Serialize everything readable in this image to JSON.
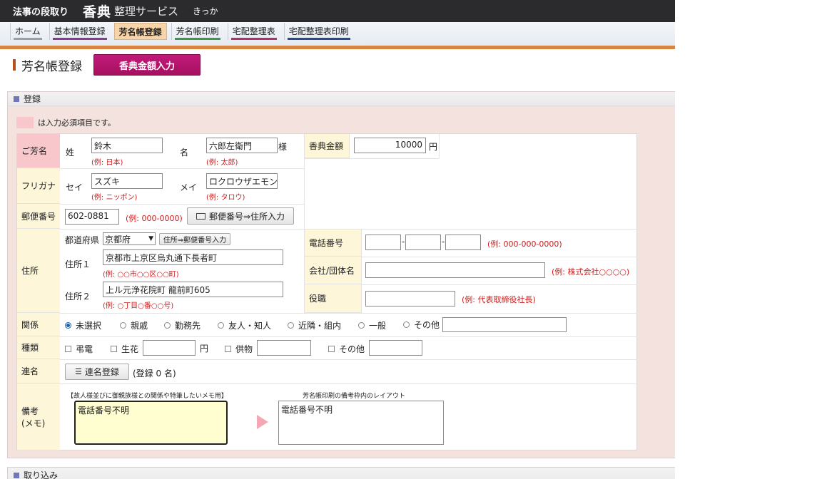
{
  "header": {
    "t1": "法事の段取り",
    "t2": "香典",
    "t3": "整理サービス",
    "t4": "きっか"
  },
  "nav": [
    {
      "label": "ホーム",
      "color": "#9aa0a6"
    },
    {
      "label": "基本情報登録",
      "color": "#8b3a8f"
    },
    {
      "label": "芳名帳登録",
      "color": "#d78541",
      "active": true
    },
    {
      "label": "芳名帳印刷",
      "color": "#3a9a4a"
    },
    {
      "label": "宅配整理表",
      "color": "#b0306a"
    },
    {
      "label": "宅配整理表印刷",
      "color": "#2a4a8f"
    }
  ],
  "page": {
    "title": "芳名帳登録",
    "koden_button": "香典金額入力"
  },
  "panel": {
    "title": "登録",
    "legend": "は入力必須項目です。",
    "panel2_title": "取り込み"
  },
  "form": {
    "name": {
      "label": "ご芳名",
      "sei_label": "姓",
      "mei_label": "名",
      "sama": "様",
      "sei_value": "鈴木",
      "mei_value": "六郎左衛門",
      "sei_example": "(例: 日本)",
      "mei_example": "(例: 太郎)"
    },
    "kana": {
      "label": "フリガナ",
      "sei_label": "セイ",
      "mei_label": "メイ",
      "sei_value": "スズキ",
      "mei_value": "ロクロウザエモン",
      "sei_example": "(例: ニッポン)",
      "mei_example": "(例: タロウ)"
    },
    "amount": {
      "label": "香典金額",
      "value": "10000",
      "unit": "円"
    },
    "postal": {
      "label": "郵便番号",
      "value": "602-0881",
      "example": "(例: 000-0000)",
      "button": "郵便番号⇒住所入力"
    },
    "address": {
      "label": "住所",
      "pref_label": "都道府県",
      "pref_value": "京都府",
      "pref_button": "住所⇒郵便番号入力",
      "addr1_label": "住所１",
      "addr1_value": "京都市上京区烏丸通下長者町",
      "addr1_example": "(例: ○○市○○区○○町)",
      "addr2_label": "住所２",
      "addr2_value": "上ル元浄花院町 龍前町605",
      "addr2_example": "(例: ○丁目○番○○号)"
    },
    "phone": {
      "label": "電話番号",
      "p1": "",
      "p2": "",
      "p3": "",
      "sep": "-",
      "example": "(例: 000-000-0000)"
    },
    "company": {
      "label": "会社/団体名",
      "value": "",
      "example": "(例: 株式会社○○○○)"
    },
    "position": {
      "label": "役職",
      "value": "",
      "example": "(例: 代表取締役社長)"
    },
    "relation": {
      "label": "関係",
      "options": [
        "未選択",
        "親戚",
        "勤務先",
        "友人・知人",
        "近隣・組内",
        "一般",
        "その他"
      ],
      "selected": "未選択",
      "other_value": ""
    },
    "type": {
      "label": "種類",
      "telegram": "弔電",
      "flower": "生花",
      "flower_unit": "円",
      "offering": "供物",
      "other": "その他"
    },
    "joint": {
      "label": "連名",
      "button": "連名登録",
      "count": "(登録 0 名)"
    },
    "memo": {
      "label1": "備考",
      "label2": "(メモ)",
      "note_title": "【故人様並びに御親族様との関係や特筆したいメモ用】",
      "layout_title": "芳名帳印刷の備考枠内のレイアウト",
      "memo_value": "電話番号不明",
      "preview_value": "電話番号不明"
    }
  }
}
